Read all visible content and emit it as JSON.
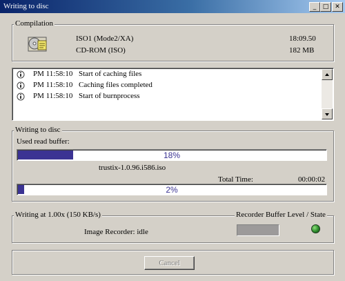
{
  "window": {
    "title": "Writing to disc"
  },
  "compilation": {
    "legend": "Compilation",
    "name": "ISO1 (Mode2/XA)",
    "type": "CD-ROM (ISO)",
    "duration": "18:09.50",
    "size": "182 MB"
  },
  "log": [
    {
      "time": "PM 11:58:10",
      "message": "Start of caching files"
    },
    {
      "time": "PM 11:58:10",
      "message": "Caching files completed"
    },
    {
      "time": "PM 11:58:10",
      "message": "Start of burnprocess"
    }
  ],
  "writing": {
    "legend": "Writing to disc",
    "buffer_label": "Used read buffer:",
    "buffer_percent_text": "18%",
    "buffer_fraction": 0.18,
    "file_name": "trustix-1.0.96.i586.iso",
    "total_time_label": "Total Time:",
    "total_time_value": "00:00:02",
    "progress_percent_text": "2%",
    "progress_fraction": 0.02
  },
  "speed": {
    "legend": "Writing at 1.00x (150 KB/s)",
    "recorder_status": "Image Recorder: idle",
    "buffer_level_legend": "Recorder Buffer Level / State",
    "state_color": "#2b8a2b"
  },
  "actions": {
    "cancel_label": "Cancel"
  },
  "icons": {
    "compilation": "cd-compilation-icon",
    "log_entry": "info-icon"
  }
}
